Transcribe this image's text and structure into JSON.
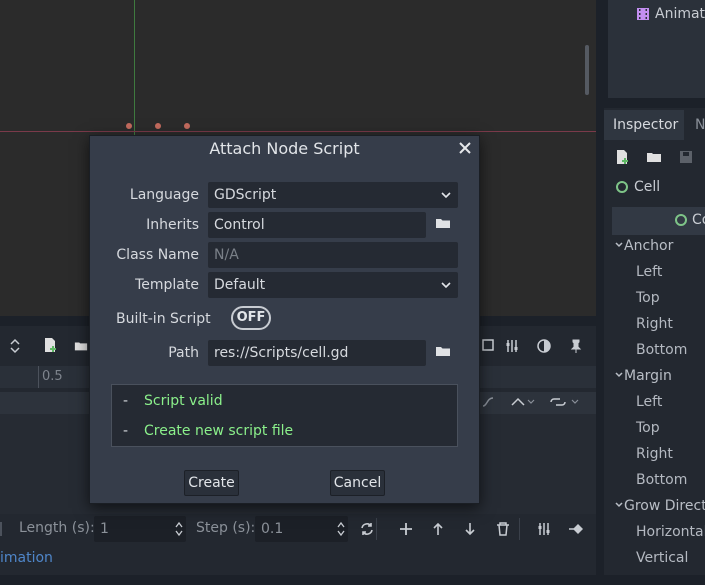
{
  "dialog": {
    "title": "Attach Node Script",
    "language_label": "Language",
    "language_value": "GDScript",
    "inherits_label": "Inherits",
    "inherits_value": "Control",
    "class_name_label": "Class Name",
    "class_name_placeholder": "N/A",
    "template_label": "Template",
    "template_value": "Default",
    "builtin_label": "Built-in Script",
    "builtin_toggle": "OFF",
    "path_label": "Path",
    "path_value": "res://Scripts/cell.gd",
    "status": [
      {
        "dash": "-",
        "text": "Script valid"
      },
      {
        "dash": "-",
        "text": "Create new script file"
      }
    ],
    "create_label": "Create",
    "cancel_label": "Cancel"
  },
  "inspector": {
    "tab_label": "Inspector",
    "tab_next": "N",
    "node_name": "Cell",
    "header_label": "Co",
    "anchor_section": "Anchor",
    "anchor_items": [
      "Left",
      "Top",
      "Right",
      "Bottom"
    ],
    "margin_section": "Margin",
    "margin_items": [
      "Left",
      "Top",
      "Right",
      "Bottom"
    ],
    "grow_section": "Grow Directi",
    "grow_items": [
      "Horizontal",
      "Vertical"
    ]
  },
  "scene_tree": {
    "animation_node": "Animati"
  },
  "animation_panel": {
    "timeline_mark": "0.5",
    "length_label": "Length (s):",
    "length_value": "1",
    "step_label": "Step (s):",
    "step_value": "0.1",
    "bottom_link": "imation"
  },
  "colors": {
    "dialog_bg": "#363d4a",
    "status_ok": "#8bf08b",
    "accent_link": "#4f86c9"
  }
}
